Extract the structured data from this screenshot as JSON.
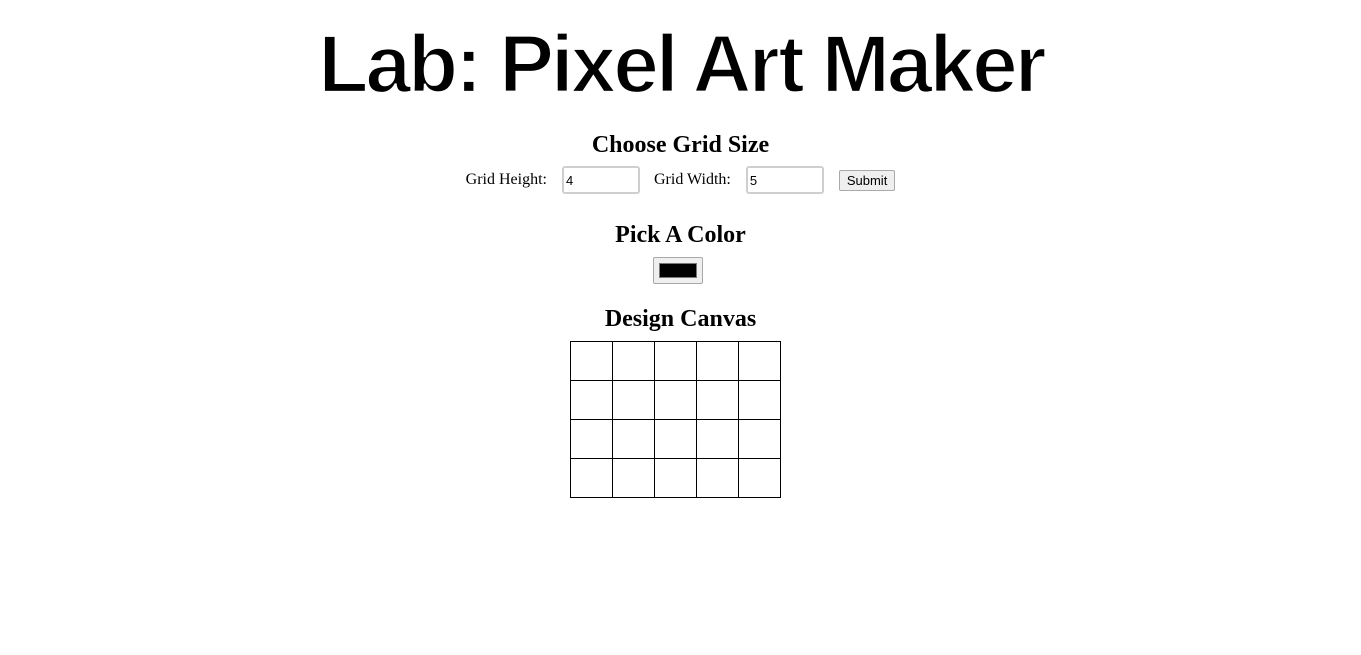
{
  "title": {
    "text": "Lab: Pixel Art Maker"
  },
  "grid_size": {
    "heading": "Choose Grid Size",
    "height_label": "Grid Height:",
    "height_value": "4",
    "width_label": "Grid Width:",
    "width_value": "5",
    "submit_label": "Submit"
  },
  "color": {
    "heading": "Pick A Color",
    "value": "#000000"
  },
  "canvas": {
    "heading": "Design Canvas",
    "rows": 4,
    "columns": 5,
    "cell_color": "#ffffff",
    "border_color": "#000000"
  }
}
